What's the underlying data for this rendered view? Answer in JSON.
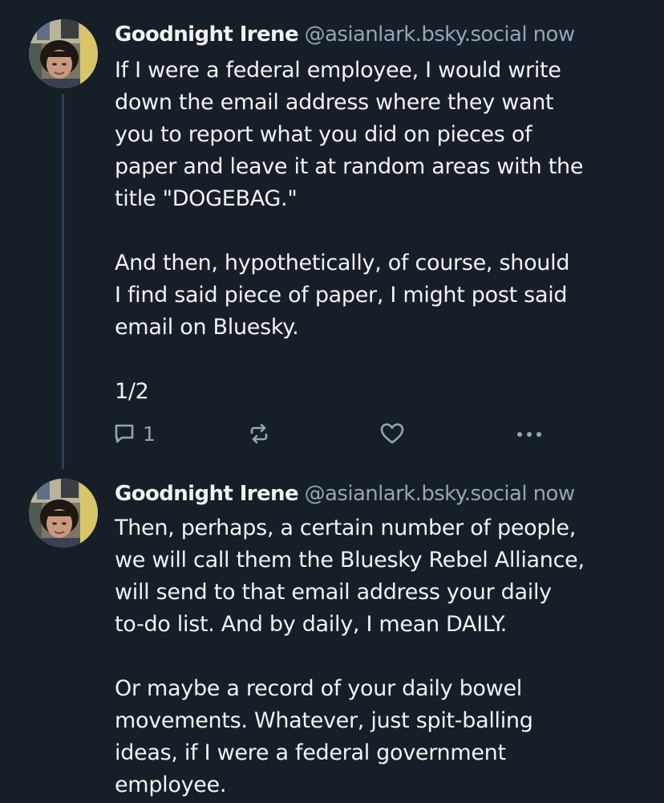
{
  "thread": {
    "posts": [
      {
        "author_name": "Goodnight Irene",
        "handle": "@asianlark.bsky.social",
        "timestamp": "now",
        "text": "If I were a federal employee, I would write\ndown the email address where they want\nyou to report what you did on pieces of\npaper and leave it at random areas with the\ntitle \"DOGEBAG.\"\n\nAnd then, hypothetically, of course, should\nI find said piece of paper, I might post said\nemail on Bluesky.\n\n1/2",
        "reply_count": "1"
      },
      {
        "author_name": "Goodnight Irene",
        "handle": "@asianlark.bsky.social",
        "timestamp": "now",
        "text": "Then, perhaps, a certain number of people,\nwe will call them the Bluesky Rebel Alliance,\nwill send to that email address your daily\nto-do list. And by daily, I mean DAILY.\n\nOr maybe a record of your daily bowel\nmovements. Whatever, just spit-balling\nideas, if I were a federal government\nemployee."
      }
    ]
  },
  "icons": {
    "reply": "speech-bubble-icon",
    "repost": "repost-arrows-icon",
    "like": "heart-icon",
    "more": "ellipsis-icon"
  },
  "colors": {
    "background": "#161e27",
    "text_primary": "#f1f3f5",
    "text_secondary": "#93a5b7",
    "thread_line": "#2d3f55"
  }
}
